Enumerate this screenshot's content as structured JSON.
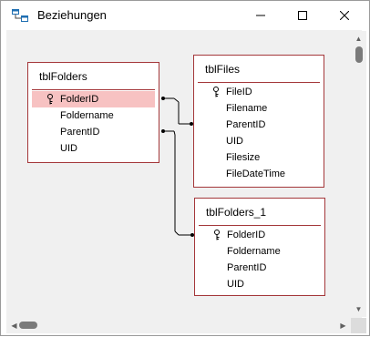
{
  "window": {
    "title": "Beziehungen",
    "minimize_label": "",
    "maximize_label": "",
    "close_label": ""
  },
  "tables": {
    "tblFolders": {
      "name": "tblFolders",
      "fields": [
        "FolderID",
        "Foldername",
        "ParentID",
        "UID"
      ],
      "primary_key": "FolderID",
      "selected_field": "FolderID"
    },
    "tblFiles": {
      "name": "tblFiles",
      "fields": [
        "FileID",
        "Filename",
        "ParentID",
        "UID",
        "Filesize",
        "FileDateTime"
      ],
      "primary_key": "FileID"
    },
    "tblFolders_1": {
      "name": "tblFolders_1",
      "fields": [
        "FolderID",
        "Foldername",
        "ParentID",
        "UID"
      ],
      "primary_key": "FolderID"
    }
  },
  "relationships": [
    {
      "from": "tblFolders.FolderID",
      "to": "tblFiles.ParentID"
    },
    {
      "from": "tblFolders.ParentID",
      "to": "tblFolders_1.FolderID"
    }
  ],
  "colors": {
    "table_border": "#a4373a",
    "selected_field": "#f7c2c2",
    "canvas": "#f0f0f0"
  }
}
